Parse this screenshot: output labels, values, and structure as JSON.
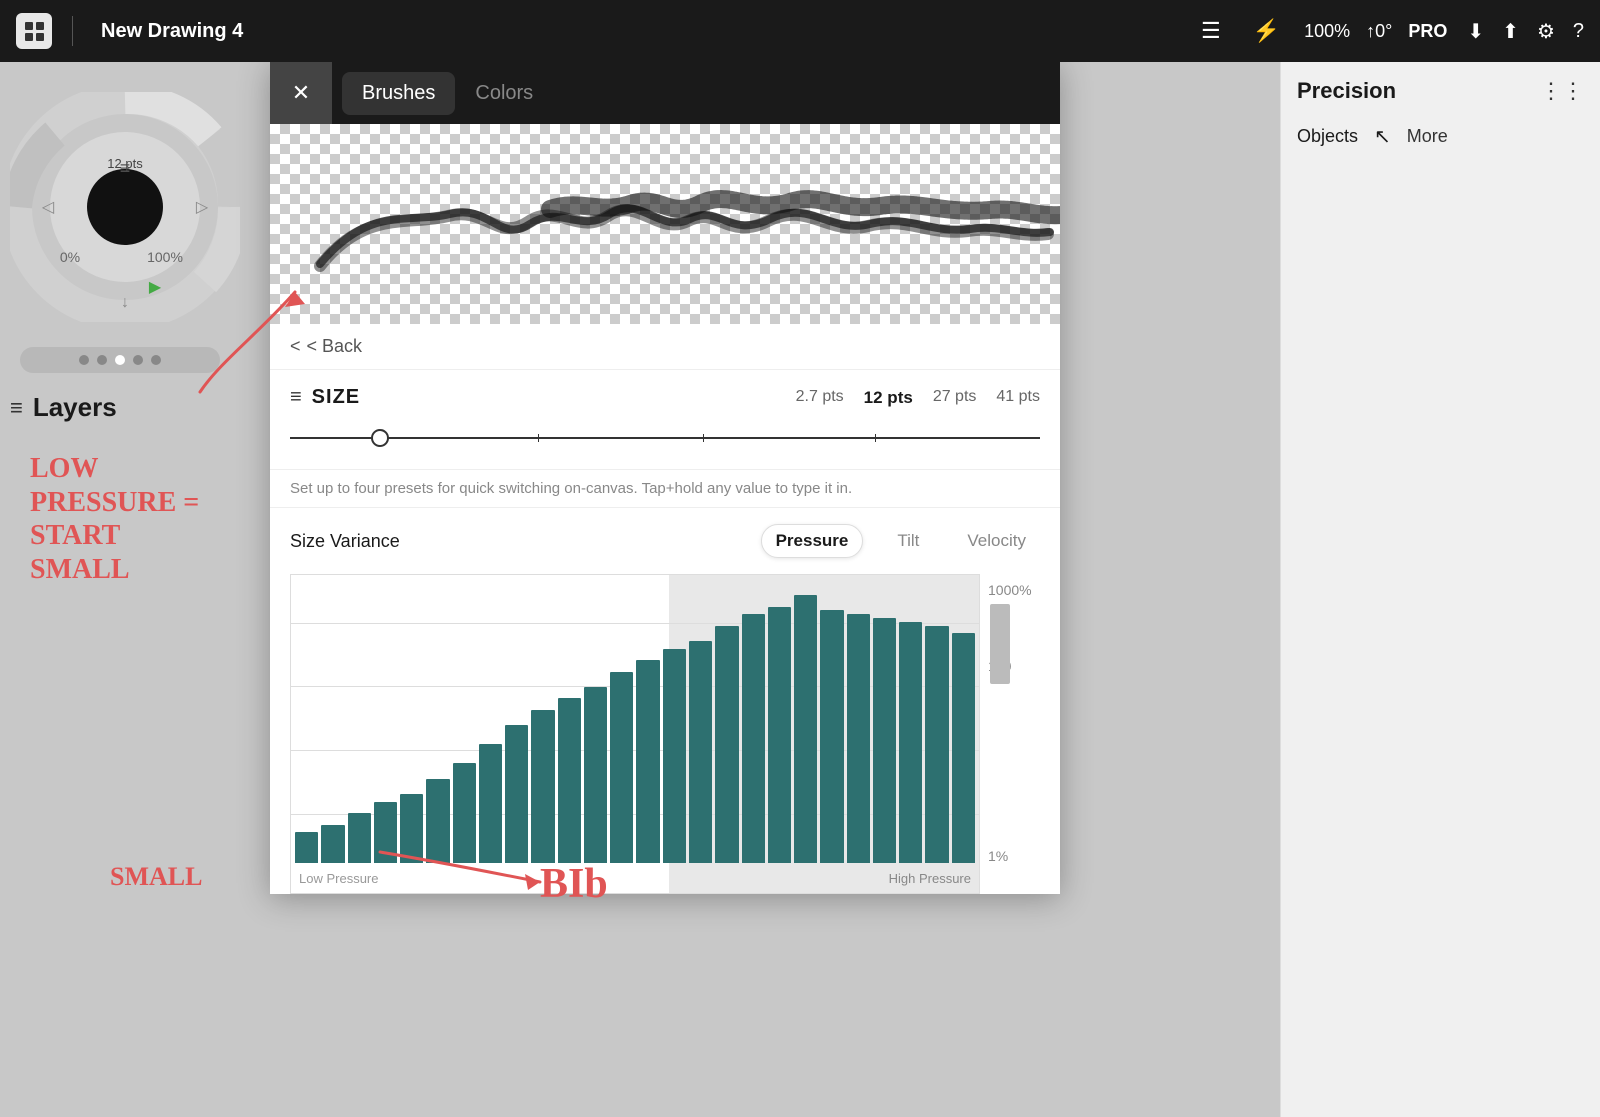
{
  "topBar": {
    "title": "New Drawing 4",
    "zoom": "100%",
    "rotation": "↑0°",
    "pro": "PRO",
    "downloadIcon": "⬇",
    "shareIcon": "⬆",
    "settingsIcon": "⚙",
    "helpIcon": "?"
  },
  "rightPanel": {
    "precision": "Precision",
    "objects": "Objects",
    "more": "More"
  },
  "leftPanel": {
    "layers": "Layers"
  },
  "modal": {
    "tabs": [
      "Brushes",
      "Colors"
    ],
    "activeTab": "Brushes",
    "backLabel": "< Back",
    "size": {
      "title": "SIZE",
      "presets": [
        "2.7 pts",
        "12 pts",
        "27 pts",
        "41 pts"
      ],
      "activePreset": "12 pts"
    },
    "helperText": "Set up to four presets for quick switching on-canvas. Tap+hold any value to type it in.",
    "variance": {
      "label": "Size Variance",
      "tabs": [
        "Pressure",
        "Tilt",
        "Velocity"
      ],
      "activeTab": "Pressure"
    },
    "chart": {
      "yLabels": [
        "1000%",
        "100",
        "1%"
      ],
      "xLabels": [
        "Low Pressure",
        "High Pressure"
      ],
      "bars": [
        8,
        10,
        13,
        16,
        18,
        22,
        26,
        31,
        36,
        40,
        43,
        46,
        50,
        53,
        56,
        58,
        62,
        65,
        67,
        70,
        66,
        65,
        64,
        63,
        62,
        60
      ],
      "highlightStart": 14
    }
  },
  "annotations": {
    "lowPressure": "LOW\nPRESSURE =\nSTART\nSMALL",
    "small": "SMALL",
    "bib": "BIb"
  },
  "wheelLabels": {
    "pts": "12 pts",
    "pct0": "0%",
    "pct100": "100%"
  },
  "progressDots": [
    false,
    false,
    true,
    false,
    false
  ]
}
